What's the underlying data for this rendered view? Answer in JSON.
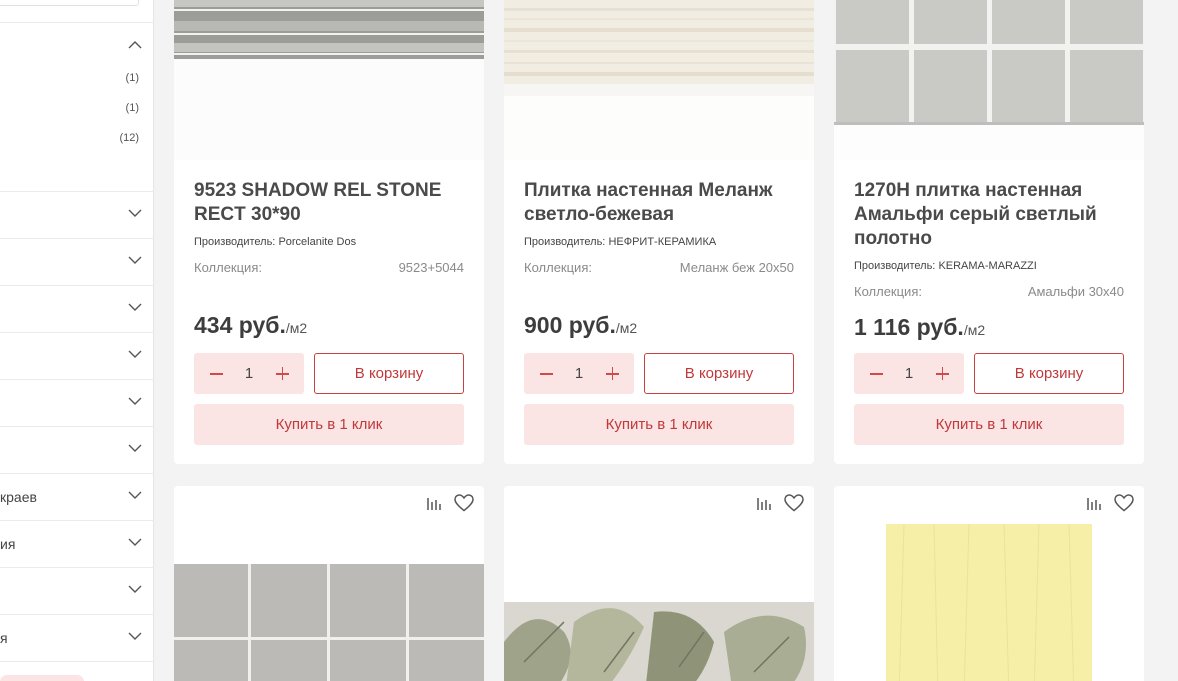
{
  "sidebar": {
    "counts": [
      "(1)",
      "(1)",
      "(12)"
    ],
    "rows": [
      {
        "label": ""
      },
      {
        "label": ""
      },
      {
        "label": ""
      },
      {
        "label": ""
      },
      {
        "label": ""
      },
      {
        "label": ""
      },
      {
        "label": "краев"
      },
      {
        "label": "ия"
      },
      {
        "label": ""
      },
      {
        "label": "я"
      }
    ]
  },
  "products": [
    {
      "title": "9523 SHADOW REL STONE RECT 30*90",
      "maker_label": "Производитель:",
      "maker": "Porcelanite Dos",
      "collection_label": "Коллекция:",
      "collection": "9523+5044",
      "price": "434 руб.",
      "unit": "/м2",
      "qty": "1",
      "cart_label": "В корзину",
      "oneclick_label": "Купить в 1 клик"
    },
    {
      "title": "Плитка настенная Меланж светло-бежевая",
      "maker_label": "Производитель:",
      "maker": "НЕФРИТ-КЕРАМИКА",
      "collection_label": "Коллекция:",
      "collection": "Меланж беж 20x50",
      "price": "900 руб.",
      "unit": "/м2",
      "qty": "1",
      "cart_label": "В корзину",
      "oneclick_label": "Купить в 1 клик"
    },
    {
      "title": "1270H плитка настенная Амальфи серый светлый полотно",
      "maker_label": "Производитель:",
      "maker": "KERAMA-MARAZZI",
      "collection_label": "Коллекция:",
      "collection": "Амальфи 30x40",
      "price": "1 116 руб.",
      "unit": "/м2",
      "qty": "1",
      "cart_label": "В корзину",
      "oneclick_label": "Купить в 1 клик"
    }
  ],
  "colors": {
    "accent": "#c0393a",
    "accent_light": "#fbe4e4",
    "background": "#f3f3f3"
  },
  "icons": [
    "compare-icon",
    "heart-icon",
    "chevron-up-icon",
    "chevron-down-icon",
    "minus-icon",
    "plus-icon"
  ]
}
